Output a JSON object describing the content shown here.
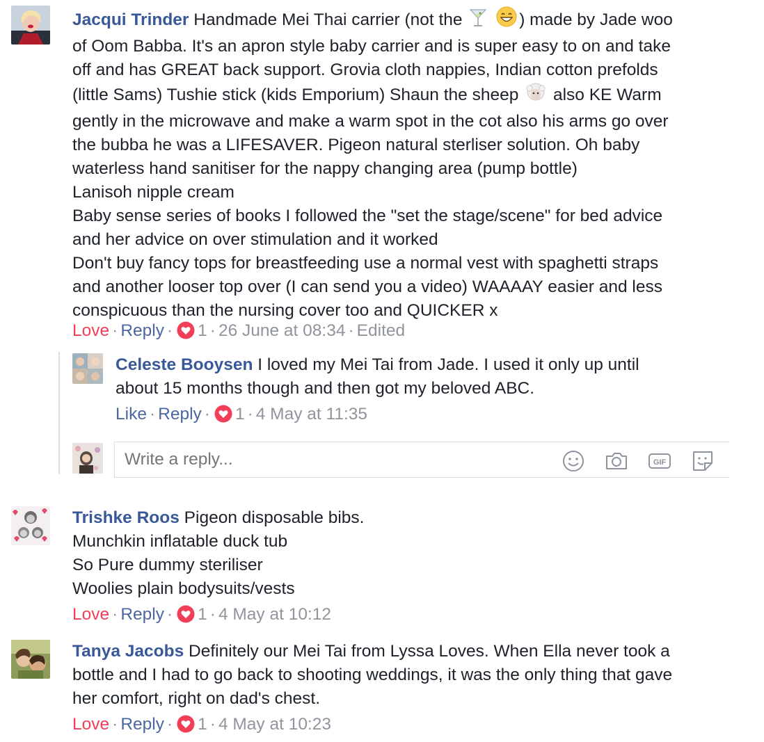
{
  "comments": [
    {
      "author": "Jacqui Trinder",
      "lines": [
        "Handmade Mei Thai carrier (not the",
        ") made by Jade woo",
        "of Oom Babba. It's an apron style baby carrier and is super easy to on and take",
        "off and has GREAT back support. Grovia cloth nappies, Indian cotton prefolds",
        "(little Sams) Tushie stick (kids Emporium) Shaun the sheep",
        " also KE Warm",
        "gently in the microwave and make a warm spot in the cot also his arms go over",
        "the bubba he was a LIFESAVER. Pigeon natural sterliser solution. Oh baby",
        "waterless hand sanitiser for the nappy changing area (pump bottle)",
        "Lanisoh nipple cream",
        "Baby sense series of books I followed the \"set the stage/scene\" for bed advice",
        "and her advice on over stimulation and it worked",
        "Don't buy fancy tops for breastfeeding use a normal vest with spaghetti straps",
        "and another looser top over (I can send you a video) WAAAAY easier and less",
        "conspicuous than the nursing cover too and QUICKER x"
      ],
      "emojis": [
        "cocktail-glass",
        "grinning-face",
        "sheep-face"
      ],
      "action1": "Love",
      "action2": "Reply",
      "reactions": "1",
      "timestamp": "26 June at 08:34",
      "edited": "Edited"
    },
    {
      "author": "Celeste Booysen",
      "lines": [
        "I loved my Mei Tai from Jade. I used it only up until",
        "about 15 months though and then got my beloved ABC."
      ],
      "action1": "Like",
      "action2": "Reply",
      "reactions": "1",
      "timestamp": "4 May at 11:35"
    },
    {
      "author": "Trishke Roos",
      "lines": [
        "Pigeon disposable bibs.",
        "Munchkin inflatable duck tub",
        "So Pure dummy steriliser",
        "Woolies plain bodysuits/vests"
      ],
      "action1": "Love",
      "action2": "Reply",
      "reactions": "1",
      "timestamp": "4 May at 10:12"
    },
    {
      "author": "Tanya Jacobs",
      "lines": [
        "Definitely our Mei Tai from Lyssa Loves. When Ella never took a",
        "bottle and I had to go back to shooting weddings, it was the only thing that gave",
        "her comfort, right on dad's chest."
      ],
      "action1": "Love",
      "action2": "Reply",
      "reactions": "1",
      "timestamp": "4 May at 10:23"
    }
  ],
  "reply_box": {
    "placeholder": "Write a reply...",
    "icons": [
      "smiley-icon",
      "camera-icon",
      "gif-icon",
      "sticker-icon"
    ]
  },
  "colors": {
    "author": "#385898",
    "love": "#f33e58",
    "link": "#4b67a1",
    "meta": "#90949c",
    "text": "#1d2129"
  }
}
